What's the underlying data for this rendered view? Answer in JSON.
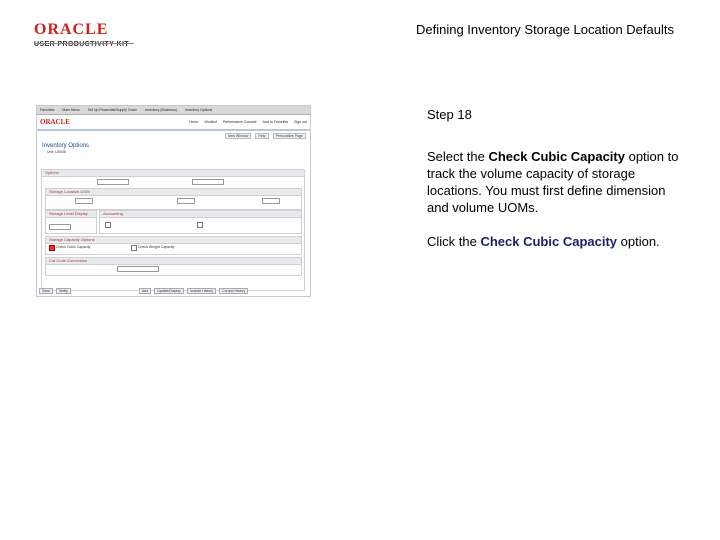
{
  "header": {
    "logo_oracle": "ORACLE",
    "logo_upk": "USER PRODUCTIVITY KIT",
    "title": "Defining Inventory Storage Location Defaults"
  },
  "screenshot": {
    "menubar": [
      "Favorites",
      "Main Menu",
      "Set Up Financials/Supply Chain",
      "Inventory (Business)",
      "Inventory Options"
    ],
    "brand": "ORACLE",
    "top_links": [
      "Home",
      "Worklist",
      "Performance Console",
      "Add to Favorites",
      "Sign out"
    ],
    "subnav": [
      "New Window",
      "Help",
      "Personalize Page"
    ],
    "page_title": "Inventory Options",
    "unit_label": "Unit: US008",
    "options_header": "Options",
    "sections": {
      "storage_uom": "Storage Location UOM",
      "storage_level": "Storage Level Display",
      "accounting": "Accounting",
      "capacity": "Storage Capacity Options",
      "conversion": "Cut Code Conversion"
    },
    "check_cubic": "Check Cubic Capacity",
    "check_weight": "Check Weight Capacity",
    "footer_buttons": [
      "Save",
      "Notify",
      "Add",
      "Update/Display",
      "Include History",
      "Correct History"
    ]
  },
  "panel": {
    "step": "Step 18",
    "instruction_pre": "Select the ",
    "instruction_bold": "Check Cubic Capacity",
    "instruction_post": " option to track the volume capacity of storage locations. You must first define dimension and volume UOMs.",
    "action_pre": "Click the ",
    "action_bold": "Check Cubic Capacity",
    "action_post": " option."
  }
}
